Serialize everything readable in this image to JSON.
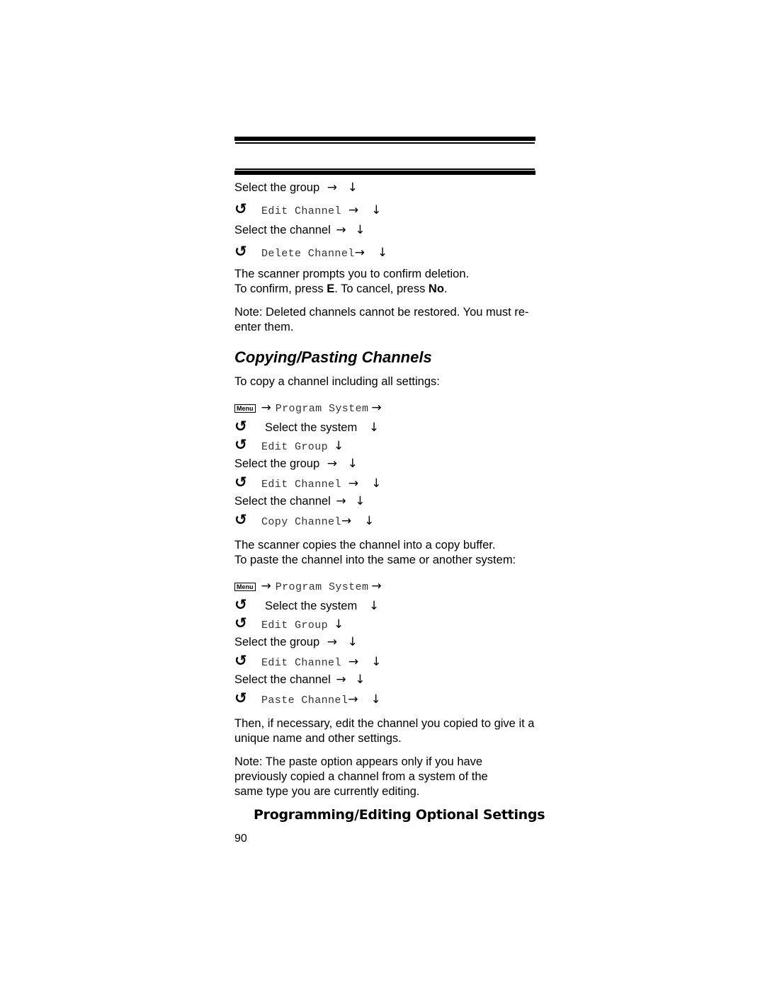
{
  "delete_steps": [
    {
      "icon": "",
      "text": "Select the group",
      "mono": false,
      "arrows": [
        "→",
        "↓"
      ]
    },
    {
      "icon": "↺",
      "text": "Edit Channel",
      "mono": true,
      "arrows": [
        "→",
        "↓"
      ]
    },
    {
      "icon": "",
      "text": "Select the channel",
      "mono": false,
      "arrows": [
        "→",
        "↓"
      ]
    },
    {
      "icon": "↺",
      "text": "Delete Channel",
      "mono": true,
      "arrows": [
        "→",
        "↓"
      ]
    }
  ],
  "delete_confirm": {
    "line1": "The scanner prompts you to confirm deletion.",
    "line2_prefix": "To confirm, press ",
    "confirm_key": "E",
    "line2_middle": ". To cancel, press ",
    "cancel_key": "No",
    "line2_suffix": "."
  },
  "delete_note": "Note: Deleted channels cannot be restored. You must re-enter them.",
  "section_heading": "Copying/Pasting Channels",
  "copy_intro": "To copy a channel including all settings:",
  "menu_key_label": "Menu",
  "copy_steps": {
    "program_system": "Program System",
    "select_system": "Select the system",
    "edit_group": "Edit Group",
    "select_group": "Select the group",
    "edit_channel": "Edit Channel",
    "select_channel": "Select the channel",
    "final_action": "Copy Channel"
  },
  "copy_result": {
    "line1": "The scanner copies the channel into a copy buffer.",
    "line2": "To paste the channel into the same or another system:"
  },
  "paste_steps": {
    "program_system": "Program System",
    "select_system": "Select the system",
    "edit_group": "Edit Group",
    "select_group": "Select the group",
    "edit_channel": "Edit Channel",
    "select_channel": "Select the channel",
    "final_action": "Paste Channel"
  },
  "paste_followup": "Then, if necessary, edit the channel you copied to give it a  unique name and other settings.",
  "paste_note": "Note: The paste option appears only if you have previously copied a channel from a system of the same type you are currently editing.",
  "icons": {
    "right_arrow": "→",
    "down_arrow": "↓",
    "scroll": "↺"
  },
  "footer": {
    "section_title": "Programming/Editing Optional Settings",
    "page_number": "90"
  }
}
